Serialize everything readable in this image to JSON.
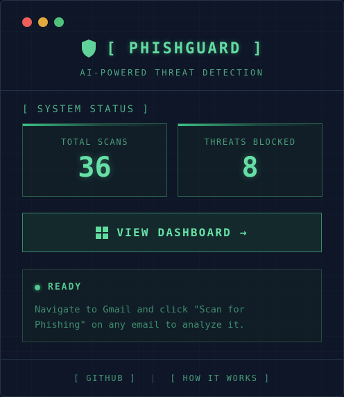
{
  "app": {
    "title": "[ PHISHGUARD ]",
    "subtitle": "AI-POWERED THREAT DETECTION",
    "shield_icon": "shield-icon",
    "accent_color": "#5fd39a"
  },
  "window_controls": [
    "close",
    "minimize",
    "zoom"
  ],
  "system_status": {
    "label": "[ SYSTEM STATUS ]",
    "stats": [
      {
        "label": "TOTAL SCANS",
        "value": "36"
      },
      {
        "label": "THREATS BLOCKED",
        "value": "8"
      }
    ]
  },
  "dashboard_button": {
    "label": "VIEW DASHBOARD →",
    "icon": "dashboard-grid-icon"
  },
  "status": {
    "state": "READY",
    "message": "Navigate to Gmail and click \"Scan for Phishing\" on any email to analyze it."
  },
  "footer": {
    "links": [
      "[ GITHUB ]",
      "[ HOW IT WORKS ]"
    ],
    "separator": "|"
  }
}
